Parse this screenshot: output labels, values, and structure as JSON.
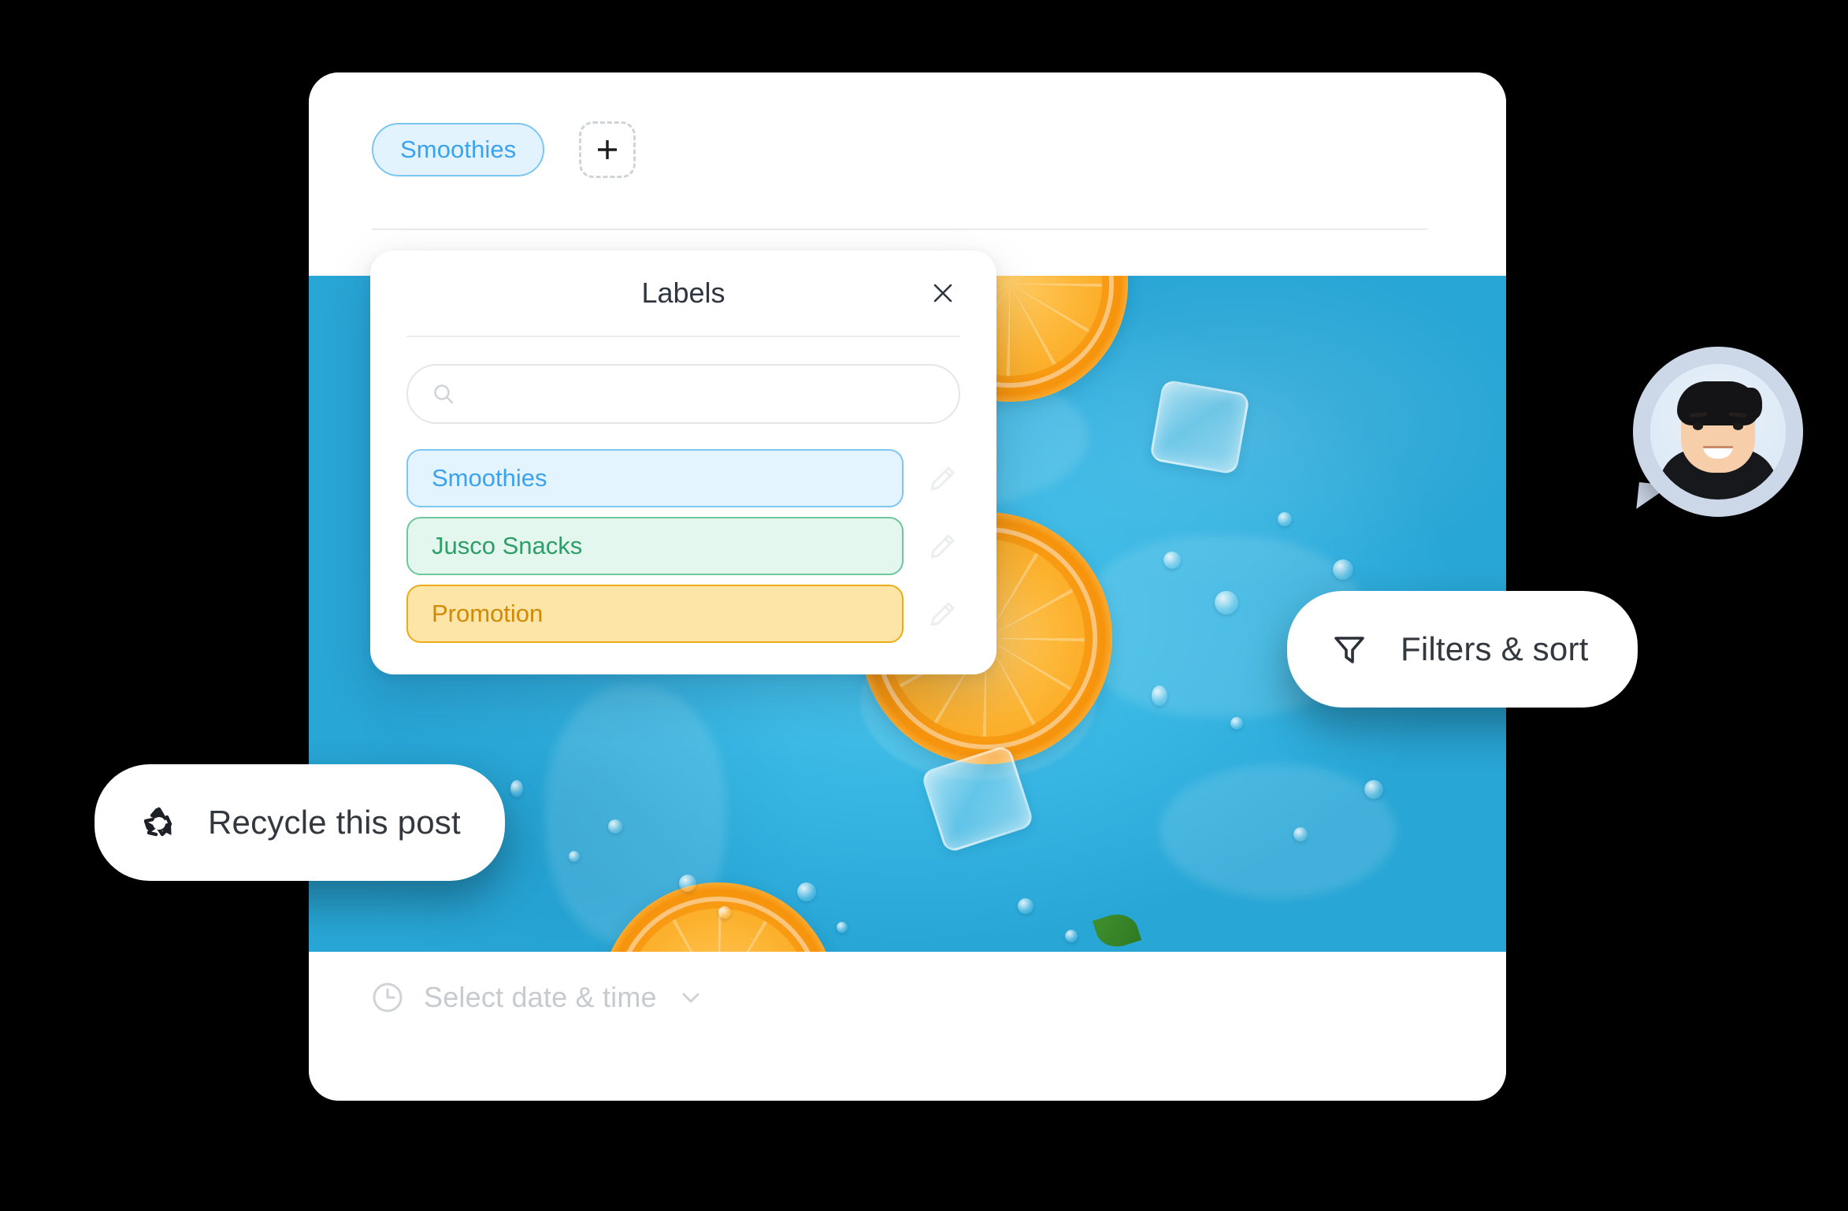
{
  "composer": {
    "tabs": [
      {
        "label": "Smoothies",
        "state": "selected",
        "color": "#3aa3f0"
      }
    ],
    "add_tab": {
      "icon": "plus-icon",
      "label": "+"
    },
    "schedule": {
      "icon": "clock-icon",
      "placeholder": "Select date & time",
      "chevron": "chevron-down-icon"
    },
    "media": {
      "alt": "Orange slices and ice cubes on a blue wet surface",
      "dominant_color": "#3bbbe8"
    }
  },
  "labels_popup": {
    "title": "Labels",
    "close_icon": "close-icon",
    "search": {
      "icon": "search-icon",
      "value": "",
      "placeholder": ""
    },
    "items": [
      {
        "name": "Smoothies",
        "color": "#3aa3f0",
        "bg": "#e4f4fe",
        "border": "#7cc6f2",
        "edit_icon": "pencil-icon"
      },
      {
        "name": "Jusco Snacks",
        "color": "#2e9e68",
        "bg": "#e4f7ee",
        "border": "#6cc79a",
        "edit_icon": "pencil-icon"
      },
      {
        "name": "Promotion",
        "color": "#d08a06",
        "bg": "#fde5a8",
        "border": "#edab19",
        "edit_icon": "pencil-icon"
      }
    ]
  },
  "floating_actions": [
    {
      "id": "recycle",
      "label": "Recycle this post",
      "icon": "recycle-icon"
    },
    {
      "id": "filters",
      "label": "Filters & sort",
      "icon": "filter-icon"
    }
  ],
  "avatar": {
    "alt": "User profile photo",
    "ring_color": "#ccd7e8"
  }
}
